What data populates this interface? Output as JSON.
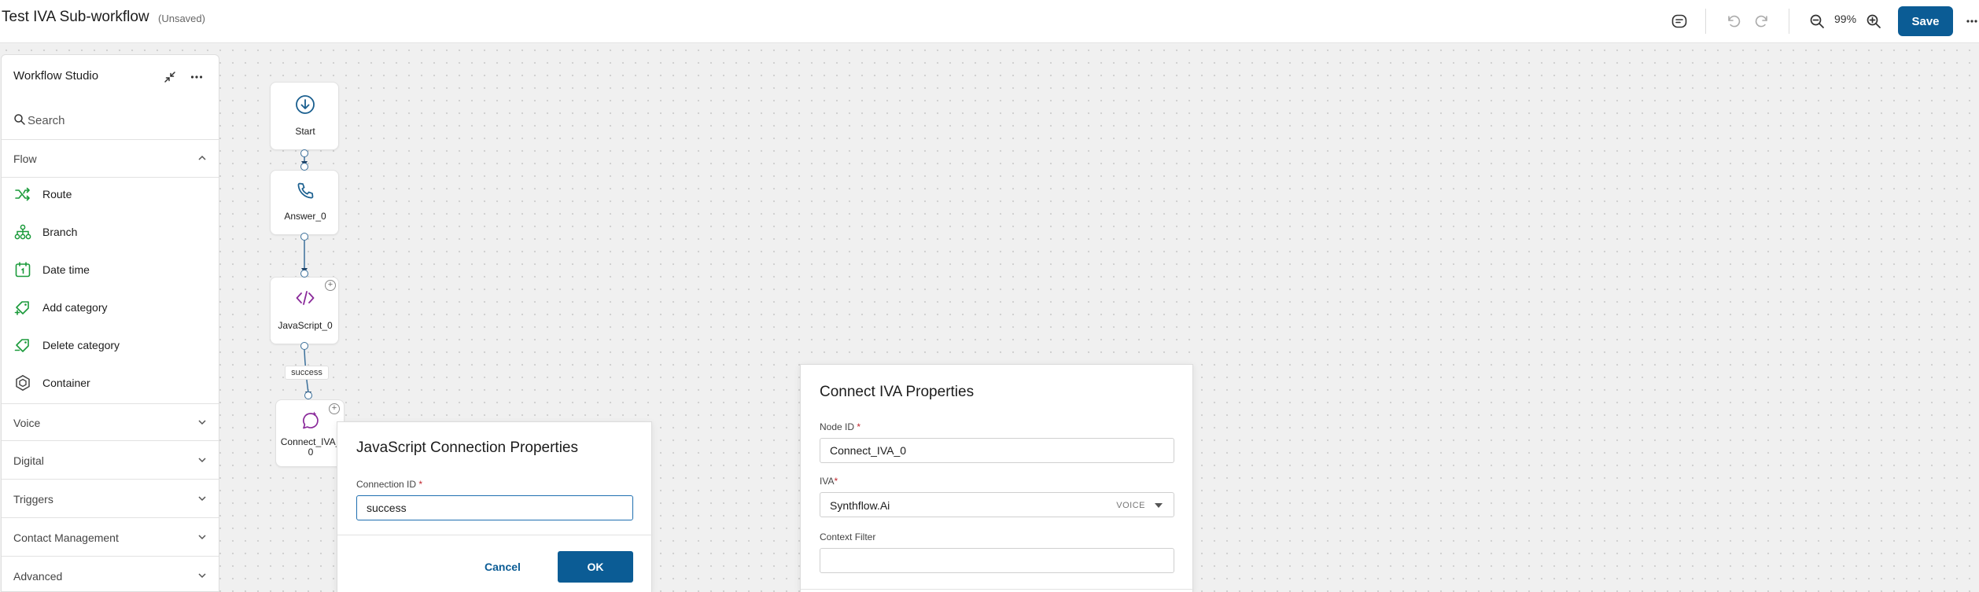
{
  "header": {
    "title": "Test IVA Sub-workflow",
    "status": "(Unsaved)",
    "zoom": "99%",
    "save_label": "Save",
    "icons": [
      "sticky-note-icon",
      "undo-icon",
      "redo-icon",
      "zoom-out-icon",
      "zoom-in-icon",
      "more-vertical-icon"
    ]
  },
  "sidebar": {
    "title": "Workflow Studio",
    "search_placeholder": "Search",
    "flow_section": "Flow",
    "flow_items": [
      {
        "label": "Route",
        "icon": "shuffle-icon"
      },
      {
        "label": "Branch",
        "icon": "branch-icon"
      },
      {
        "label": "Date time",
        "icon": "calendar-icon"
      },
      {
        "label": "Add category",
        "icon": "tag-add-icon"
      },
      {
        "label": "Delete category",
        "icon": "tag-delete-icon"
      },
      {
        "label": "Container",
        "icon": "container-icon"
      }
    ],
    "sections": [
      "Voice",
      "Digital",
      "Triggers",
      "Contact Management",
      "Advanced"
    ]
  },
  "canvas": {
    "nodes": [
      {
        "label": "Start",
        "icon": "download-circle-icon"
      },
      {
        "label": "Answer_0",
        "icon": "phone-icon"
      },
      {
        "label": "JavaScript_0",
        "icon": "code-icon"
      },
      {
        "label": "Connect_IVA_0",
        "label_line1": "Connect_IVA_",
        "label_line2": "0",
        "icon": "chat-sparkle-icon"
      }
    ],
    "edge_label": "success"
  },
  "js_dialog": {
    "title": "JavaScript Connection Properties",
    "connection_id_label": "Connection ID",
    "connection_id_value": "success",
    "cancel_label": "Cancel",
    "ok_label": "OK"
  },
  "iva_dialog": {
    "title": "Connect IVA Properties",
    "node_id_label": "Node ID",
    "node_id_value": "Connect_IVA_0",
    "iva_label": "IVA",
    "iva_value": "Synthflow.Ai",
    "iva_tag": "VOICE",
    "context_filter_label": "Context Filter",
    "context_filter_value": ""
  },
  "colors": {
    "primary": "#0b5c95",
    "flow_icon_green": "#1a9a3a",
    "node_purple": "#8a2a9a",
    "node_blue": "#1a5f8f",
    "required": "#c0262d"
  }
}
